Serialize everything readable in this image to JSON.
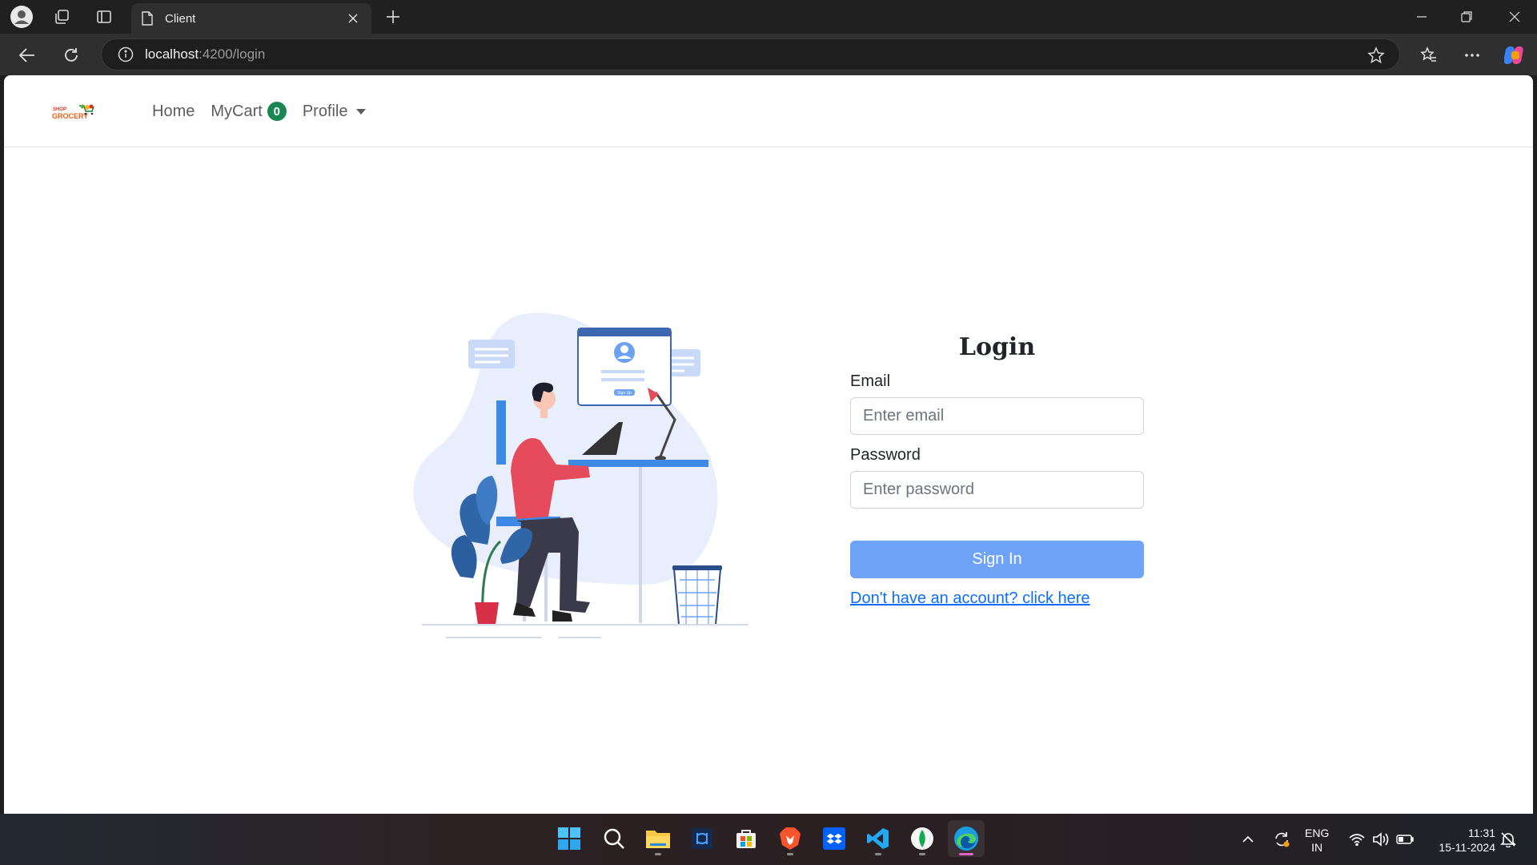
{
  "browser": {
    "tab_title": "Client",
    "url_host": "localhost",
    "url_rest": ":4200/login"
  },
  "navbar": {
    "logo_text_top": "SHOP",
    "logo_text_bottom": "GROCERY",
    "home": "Home",
    "mycart": "MyCart",
    "cart_count": "0",
    "profile": "Profile"
  },
  "illustration": {
    "button_text": "Sign Up"
  },
  "login": {
    "title": "Login",
    "email_label": "Email",
    "email_placeholder": "Enter email",
    "password_label": "Password",
    "password_placeholder": "Enter password",
    "submit": "Sign In",
    "register_link": "Don't have an account? click here"
  },
  "taskbar": {
    "lang_top": "ENG",
    "lang_bottom": "IN",
    "time": "11:31",
    "date": "15-11-2024"
  },
  "colors": {
    "primary_button": "#6ea3f7",
    "badge": "#198754",
    "link": "#0d6efd"
  }
}
